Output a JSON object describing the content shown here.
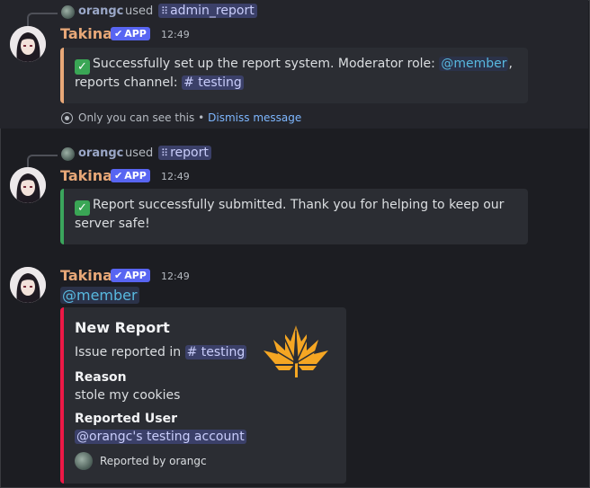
{
  "messages": [
    {
      "ref_user": "orangc",
      "ref_used": "used",
      "ref_command": "admin_report",
      "author": "Takina",
      "badge": "APP",
      "time": "12:49",
      "text_before": "Successfully set up the report system. Moderator role: ",
      "mention": "@member",
      "text_mid": ",",
      "text_line2": "reports channel: ",
      "channel": "# testing",
      "ephemeral_note": "Only you can see this •",
      "dismiss_label": "Dismiss message"
    },
    {
      "ref_user": "orangc",
      "ref_used": "used",
      "ref_command": "report",
      "author": "Takina",
      "badge": "APP",
      "time": "12:49",
      "text": "Report successfully submitted. Thank you for helping to keep our server safe!"
    },
    {
      "author": "Takina",
      "badge": "APP",
      "time": "12:49",
      "mention": "@member",
      "embed": {
        "title": "New Report",
        "desc_prefix": "Issue reported in ",
        "channel": "# testing",
        "fields": [
          {
            "name": "Reason",
            "value": "stole my cookies"
          },
          {
            "name": "Reported User",
            "value": "@orangc's testing account"
          }
        ],
        "footer": "Reported by orangc"
      }
    }
  ],
  "colors": {
    "accent_bar_1": "#e8a878",
    "accent_bar_2": "#3ba55c",
    "accent_bar_3": "#ed1846",
    "author_name": "#e8a878",
    "badge": "#5865f2",
    "thumbnail": "#f5a623"
  },
  "icons": [
    "slash-command-icon",
    "check-emoji-icon",
    "eye-icon",
    "maple-leaf-icon",
    "avatar-image"
  ]
}
